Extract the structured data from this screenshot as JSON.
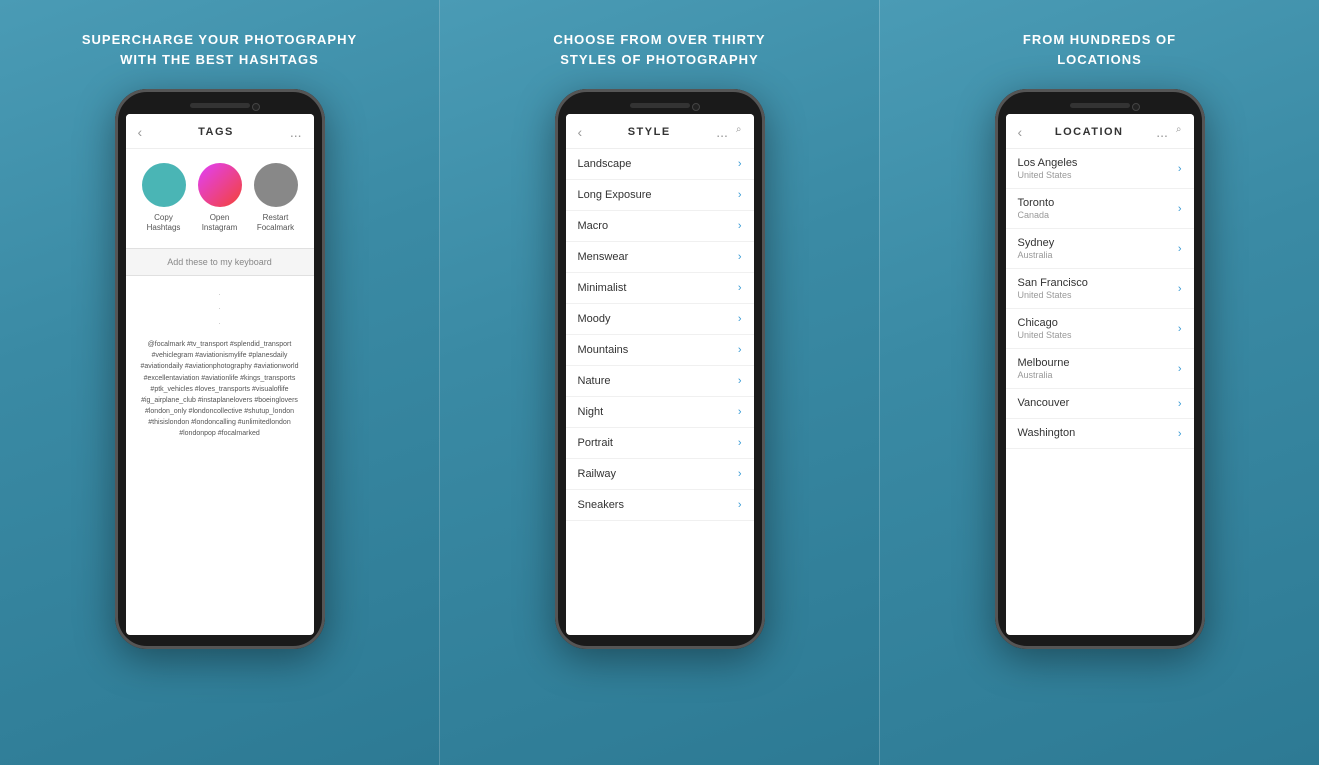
{
  "panels": [
    {
      "id": "tags",
      "title": "SUPERCHARGE YOUR PHOTOGRAPHY\nWITH THE BEST HASHTAGS",
      "screen": {
        "header": {
          "back": "‹",
          "title": "TAGS",
          "more": "..."
        },
        "actions": [
          {
            "color": "teal",
            "label": "Copy\nHashtags"
          },
          {
            "color": "pink",
            "label": "Open\nInstagram"
          },
          {
            "color": "gray",
            "label": "Restart\nFocalmark"
          }
        ],
        "keyboard_bar": "Add these to my keyboard",
        "hashtags": "@focalmark #tv_transport #splendid_transport\n#vehiclegram #aviationismylife #planesdaily\n#aviationdaily #aviationphotography #aviationworld\n#excellentaviation #aviationlife #kings_transports\n#ptk_vehicles #loves_transports #visualoflife\n#ig_airplane_club #instaplanelovers #boeinglovers\n#london_only #londoncollective #shutup_london\n#thisislondon #londoncalling #unlimitedlondon\n#londonpop #focalmarked"
      }
    },
    {
      "id": "style",
      "title": "CHOOSE FROM OVER THIRTY\nSTYLES OF PHOTOGRAPHY",
      "screen": {
        "header": {
          "back": "‹",
          "title": "STYLE",
          "more": "...",
          "search": "🔍"
        },
        "items": [
          "Landscape",
          "Long Exposure",
          "Macro",
          "Menswear",
          "Minimalist",
          "Moody",
          "Mountains",
          "Nature",
          "Night",
          "Portrait",
          "Railway",
          "Sneakers"
        ]
      }
    },
    {
      "id": "location",
      "title": "FROM HUNDREDS OF\nLOCATIONS",
      "screen": {
        "header": {
          "back": "‹",
          "title": "LOCATION",
          "more": "...",
          "search": "🔍"
        },
        "items": [
          {
            "city": "Los Angeles",
            "country": "United States"
          },
          {
            "city": "Toronto",
            "country": "Canada"
          },
          {
            "city": "Sydney",
            "country": "Australia"
          },
          {
            "city": "San Francisco",
            "country": "United States"
          },
          {
            "city": "Chicago",
            "country": "United States"
          },
          {
            "city": "Melbourne",
            "country": "Australia"
          },
          {
            "city": "Vancouver",
            "country": ""
          },
          {
            "city": "Washington",
            "country": ""
          }
        ]
      }
    }
  ]
}
